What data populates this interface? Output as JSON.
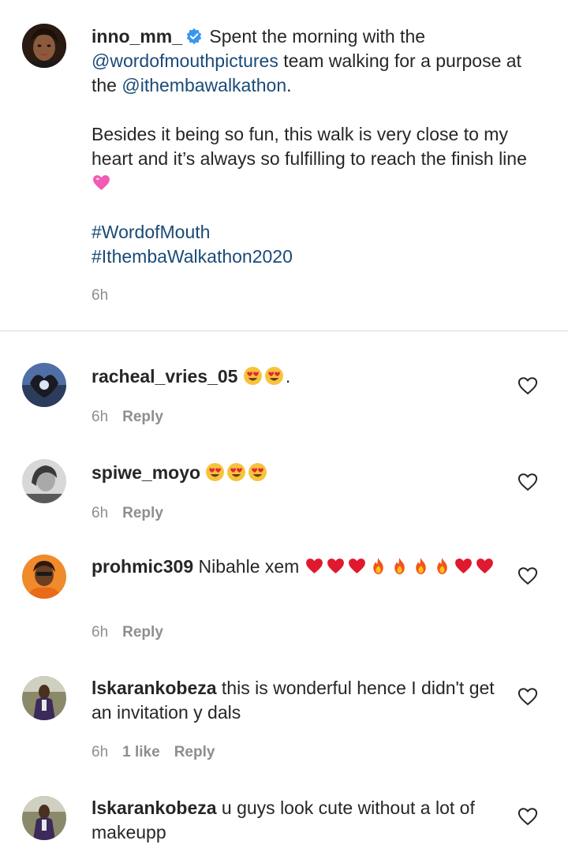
{
  "caption": {
    "username": "inno_mm_",
    "text_start": "Spent the morning with the",
    "mention_1": "@wordofmouthpictures",
    "text_mid": " team walking for a purpose at the ",
    "mention_2": "@ithembawalkathon",
    "text_end": ".",
    "paragraph_2": "Besides it being so fun, this walk is very close to my heart and it’s always so fulfilling to reach the finish line",
    "hashtag_1": "#WordofMouth",
    "hashtag_2": "#IthembaWalkathon2020",
    "time": "6h",
    "verified_icon": "verified-badge-icon"
  },
  "comments": [
    {
      "username": "racheal_vries_05",
      "text": "",
      "emoji": [
        "heart-eyes",
        "heart-eyes"
      ],
      "text_after": ".",
      "time": "6h",
      "likes": "",
      "reply": "Reply"
    },
    {
      "username": "spiwe_moyo",
      "text": "",
      "emoji": [
        "heart-eyes",
        "heart-eyes",
        "heart-eyes"
      ],
      "text_after": "",
      "time": "6h",
      "likes": "",
      "reply": "Reply"
    },
    {
      "username": "prohmic309",
      "text": "Nibahle xem",
      "emoji": [
        "red-heart",
        "red-heart",
        "red-heart",
        "fire",
        "fire",
        "fire",
        "fire",
        "red-heart",
        "red-heart"
      ],
      "text_after": "",
      "time": "6h",
      "likes": "",
      "reply": "Reply"
    },
    {
      "username": "lskarankobeza",
      "text": "this is wonderful hence I didn't get an invitation y dals",
      "emoji": [],
      "text_after": "",
      "time": "6h",
      "likes": "1 like",
      "reply": "Reply"
    },
    {
      "username": "lskarankobeza",
      "text": "u guys look cute without a lot of makeupp",
      "emoji": [],
      "text_after": "",
      "time": "",
      "likes": "",
      "reply": ""
    }
  ],
  "colors": {
    "link": "#1a4a78",
    "muted": "#8e8e8e",
    "text": "#262626",
    "verified": "#3897f0"
  }
}
